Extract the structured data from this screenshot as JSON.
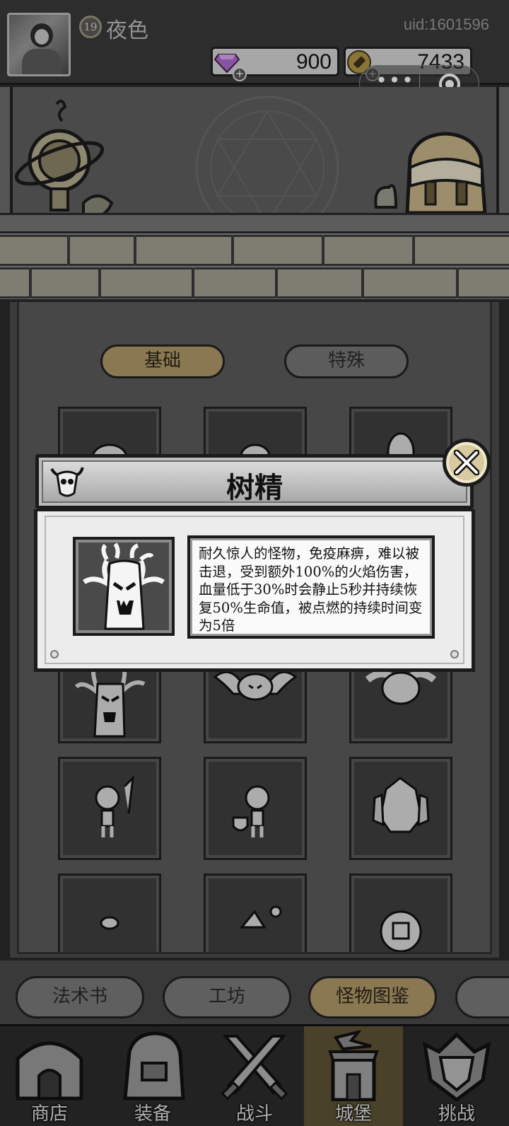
{
  "player": {
    "level": "19",
    "name": "夜色",
    "uid": "uid:1601596"
  },
  "currencies": {
    "gems": "900",
    "gold": "7433"
  },
  "category_tabs": [
    {
      "label": "基础",
      "active": true
    },
    {
      "label": "特殊",
      "active": false
    }
  ],
  "monster_grid": [
    {
      "icon": "ghost-icon"
    },
    {
      "icon": "ghost-icon"
    },
    {
      "icon": "egg-icon"
    },
    {
      "icon": "treant-icon"
    },
    {
      "icon": "bat-icon"
    },
    {
      "icon": "rabbit-icon"
    },
    {
      "icon": "skeleton-sword-icon"
    },
    {
      "icon": "skeleton-shield-icon"
    },
    {
      "icon": "rock-golem-icon"
    },
    {
      "icon": "slime-icon"
    },
    {
      "icon": "spike-icon"
    },
    {
      "icon": "stone-disc-icon"
    }
  ],
  "modal": {
    "title": "树精",
    "icon": "bull-skull-icon",
    "portrait": "treant-icon",
    "description": "耐久惊人的怪物，免疫麻痹，难以被击退，受到额外100%的火焰伤害，血量低于30%时会静止5秒并持续恢复50%生命值，被点燃的持续时间变为5倍"
  },
  "menu_tabs": [
    {
      "label": "法术书",
      "active": false
    },
    {
      "label": "工坊",
      "active": false
    },
    {
      "label": "怪物图鉴",
      "active": true
    }
  ],
  "bottom_nav": [
    {
      "label": "商店",
      "icon": "shop-hut-icon",
      "active": false
    },
    {
      "label": "装备",
      "icon": "backpack-icon",
      "active": false
    },
    {
      "label": "战斗",
      "icon": "crossed-swords-icon",
      "active": false
    },
    {
      "label": "城堡",
      "icon": "castle-icon",
      "active": true
    },
    {
      "label": "挑战",
      "icon": "shield-crest-icon",
      "active": false
    }
  ],
  "colors": {
    "accent_gold": "#b09a6a",
    "panel_dark": "#4c4c4c",
    "gem_purple": "#b06ad0"
  }
}
